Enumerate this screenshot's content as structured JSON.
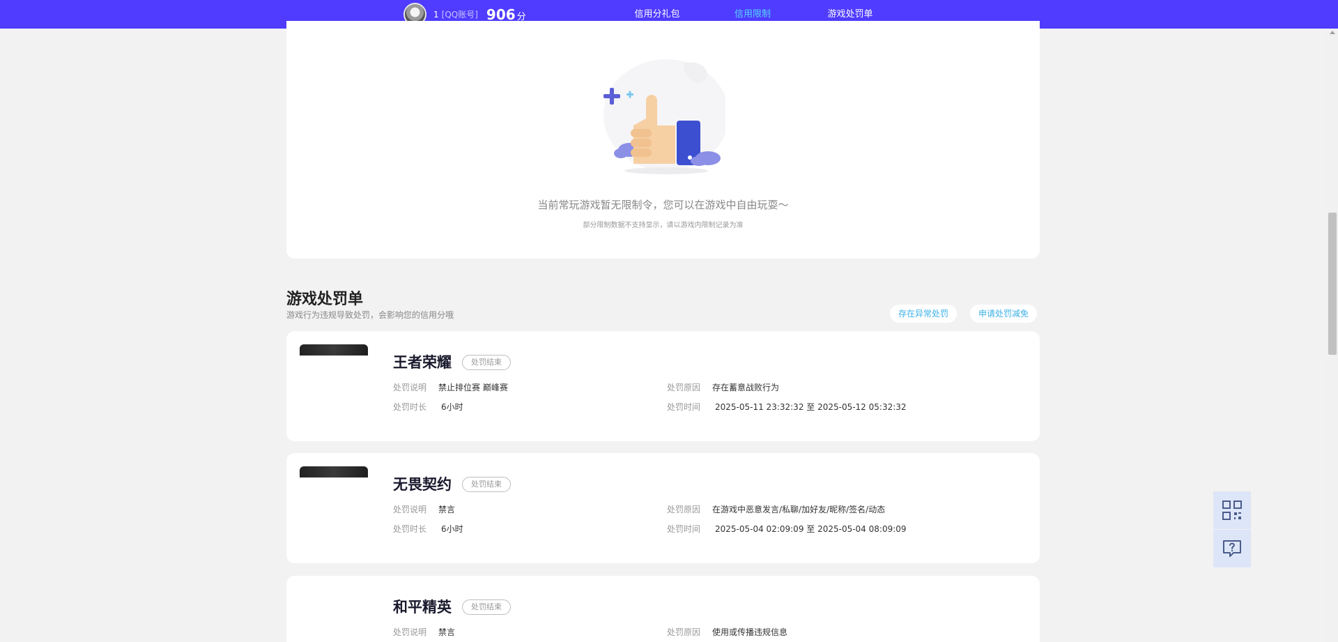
{
  "header": {
    "user_id": "1",
    "account_type": "[QQ账号]",
    "score": "906",
    "score_unit": "分",
    "tabs": [
      {
        "label": "信用分礼包"
      },
      {
        "label": "信用限制令"
      },
      {
        "label": "游戏处罚单"
      }
    ]
  },
  "empty_state": {
    "message": "当前常玩游戏暂无限制令，您可以在游戏中自由玩耍～",
    "note": "部分限制数据不支持显示，请以游戏内限制记录为准"
  },
  "penalty_section": {
    "title": "游戏处罚单",
    "subtitle": "游戏行为违规导致处罚，会影响您的信用分哦",
    "buttons": [
      "存在异常处罚",
      "申请处罚减免"
    ],
    "field_labels": {
      "description": "处罚说明",
      "duration": "处罚时长",
      "reason": "处罚原因",
      "time": "处罚时间"
    },
    "items": [
      {
        "game": "王者荣耀",
        "status": "处罚结束",
        "description": "禁止排位赛 巅峰赛",
        "duration": "6小时",
        "reason": "存在蓄意战败行为",
        "time": "2025-05-11 23:32:32 至 2025-05-12 05:32:32"
      },
      {
        "game": "无畏契约",
        "status": "处罚结束",
        "description": "禁言",
        "duration": "6小时",
        "reason": "在游戏中恶意发言/私聊/加好友/昵称/签名/动态",
        "time": "2025-05-04 02:09:09 至 2025-05-04 08:09:09"
      },
      {
        "game": "和平精英",
        "status": "处罚结束",
        "description": "禁言",
        "reason": "使用或传播违规信息"
      }
    ]
  },
  "icons": {
    "qr": "qr-code-icon",
    "help": "help-chat-icon"
  }
}
